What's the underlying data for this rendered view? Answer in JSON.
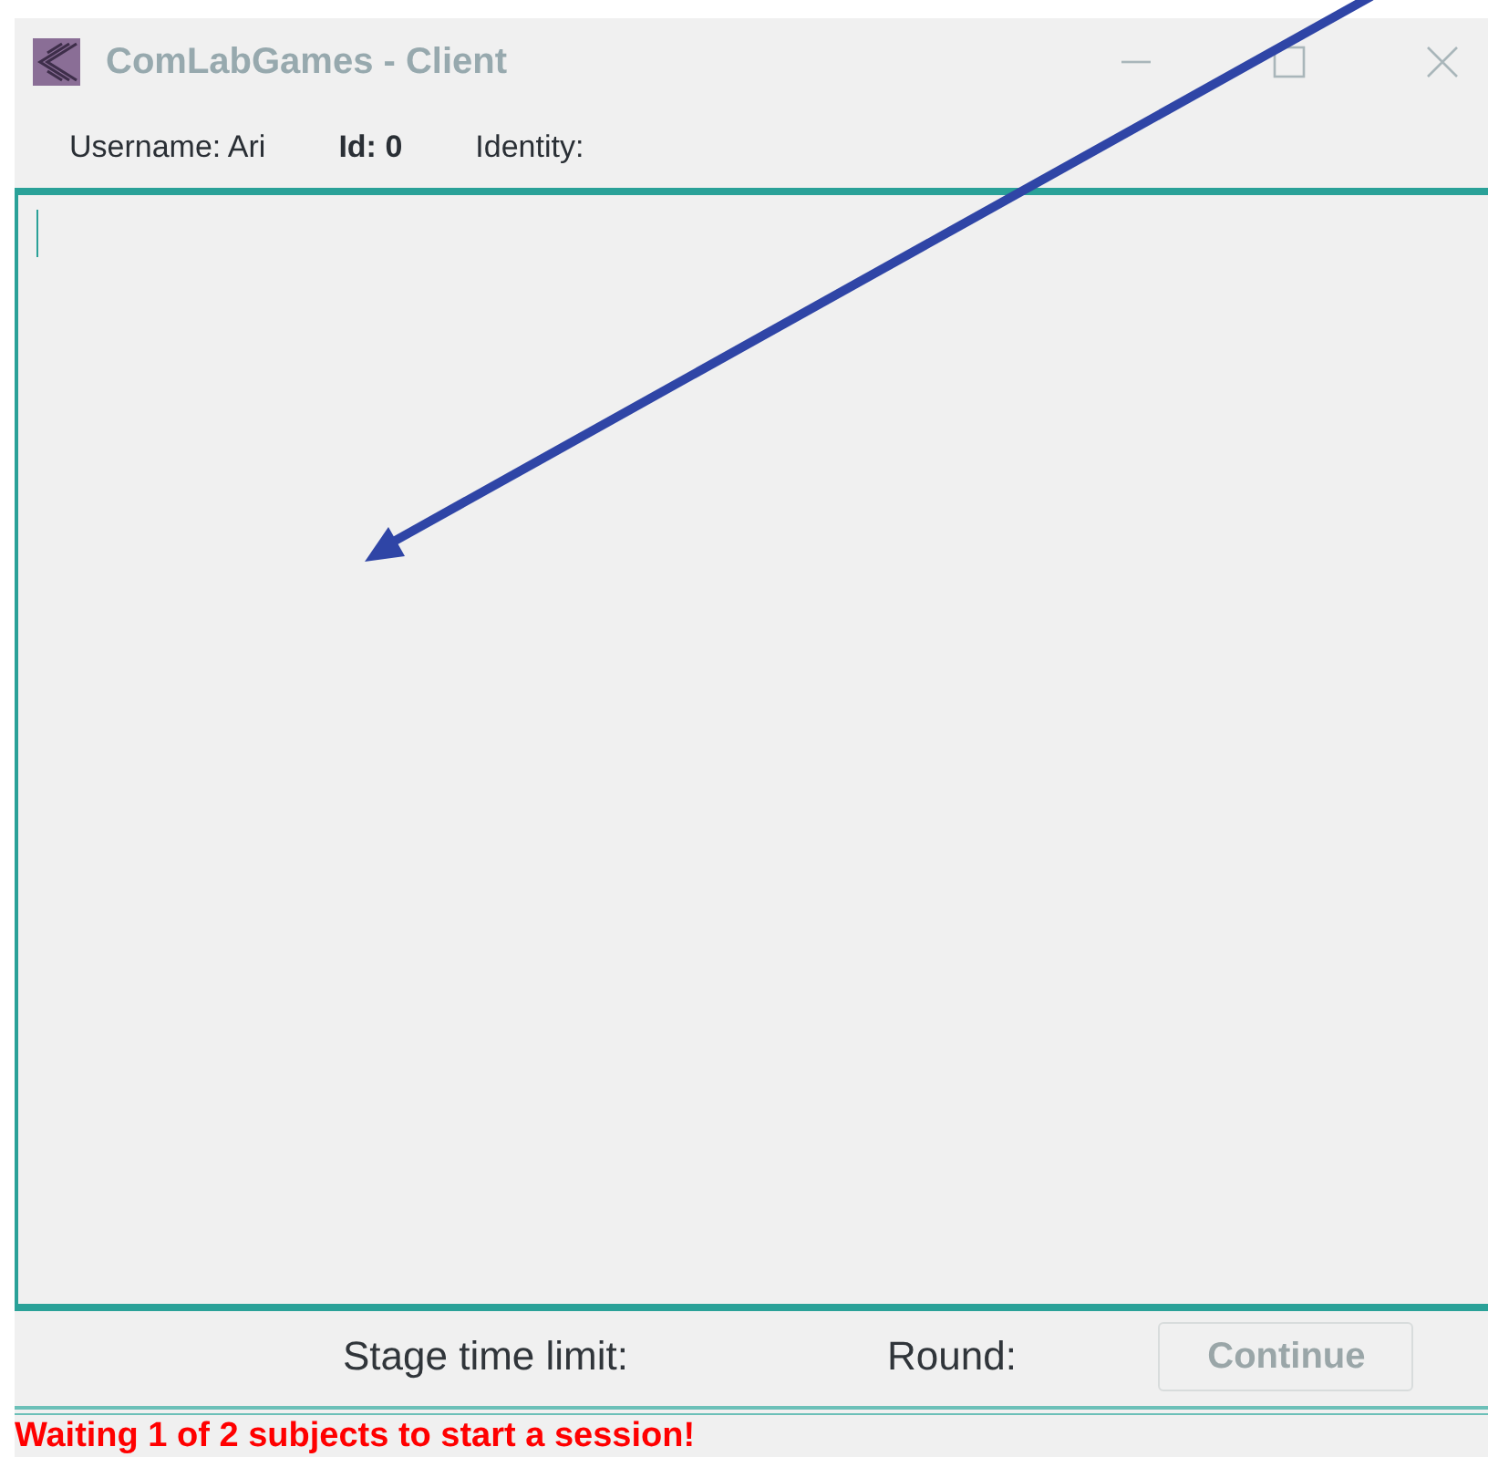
{
  "window": {
    "title": "ComLabGames - Client"
  },
  "info_bar": [
    {
      "label": "Username:",
      "value": "Ari",
      "bold": false
    },
    {
      "label": "Id:",
      "value": "0",
      "bold": true
    },
    {
      "label": "Identity:",
      "bold": false
    }
  ],
  "footer": {
    "stage_time_limit": "Stage time limit:",
    "round": "Round:",
    "continue_button": {
      "label": "Continue",
      "disabled": true
    }
  },
  "status": "Waiting 1 of 2 subjects to start a session!"
}
